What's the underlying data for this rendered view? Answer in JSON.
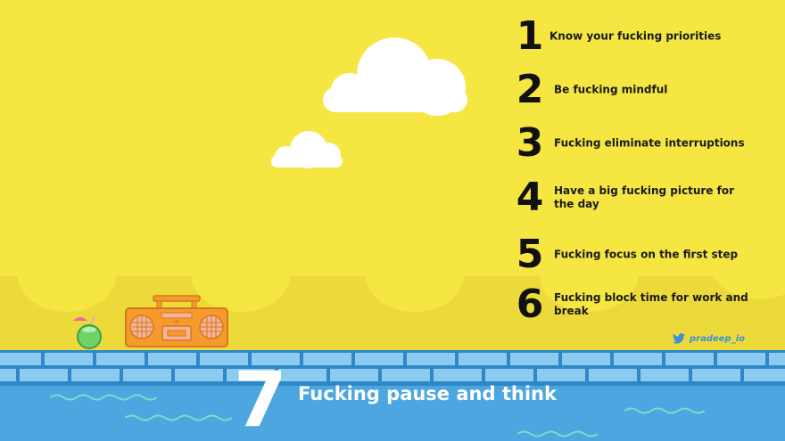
{
  "tips": [
    {
      "number": "1",
      "text": "Know your fucking priorities"
    },
    {
      "number": "2",
      "text": "Be fucking mindful"
    },
    {
      "number": "3",
      "text": "Fucking eliminate interruptions"
    },
    {
      "number": "4",
      "text": "Have a big fucking picture for the day"
    },
    {
      "number": "5",
      "text": "Fucking focus on the first step"
    },
    {
      "number": "6",
      "text": "Fucking block time for work and break"
    }
  ],
  "final_tip": {
    "number": "7",
    "text": "Fucking pause and think"
  },
  "credit": {
    "icon": "twitter-icon",
    "handle": "pradeep_io"
  },
  "colors": {
    "sky": "#f5e642",
    "scallop": "#ecd93a",
    "cloud": "#ffffff",
    "pool": "#4ca6e0",
    "tile": "#8ccbf0",
    "grout": "#2f87c7",
    "boombox": "#f79a2e",
    "coconut": "#6fd36a",
    "twitter": "#3d8fd6"
  }
}
